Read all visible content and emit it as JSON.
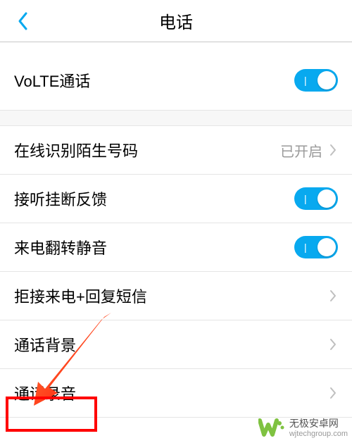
{
  "header": {
    "title": "电话"
  },
  "rows": {
    "volte": {
      "label": "VoLTE通话",
      "toggle_on": true
    },
    "caller_id": {
      "label": "在线识别陌生号码",
      "value": "已开启"
    },
    "answer_feedback": {
      "label": "接听挂断反馈",
      "toggle_on": true
    },
    "flip_mute": {
      "label": "来电翻转静音",
      "toggle_on": true
    },
    "reject_sms": {
      "label": "拒接来电+回复短信"
    },
    "call_bg": {
      "label": "通话背景"
    },
    "call_record": {
      "label": "通话录音"
    }
  },
  "watermark": {
    "title": "无极安卓网",
    "url": "wjtechgroup.com"
  }
}
